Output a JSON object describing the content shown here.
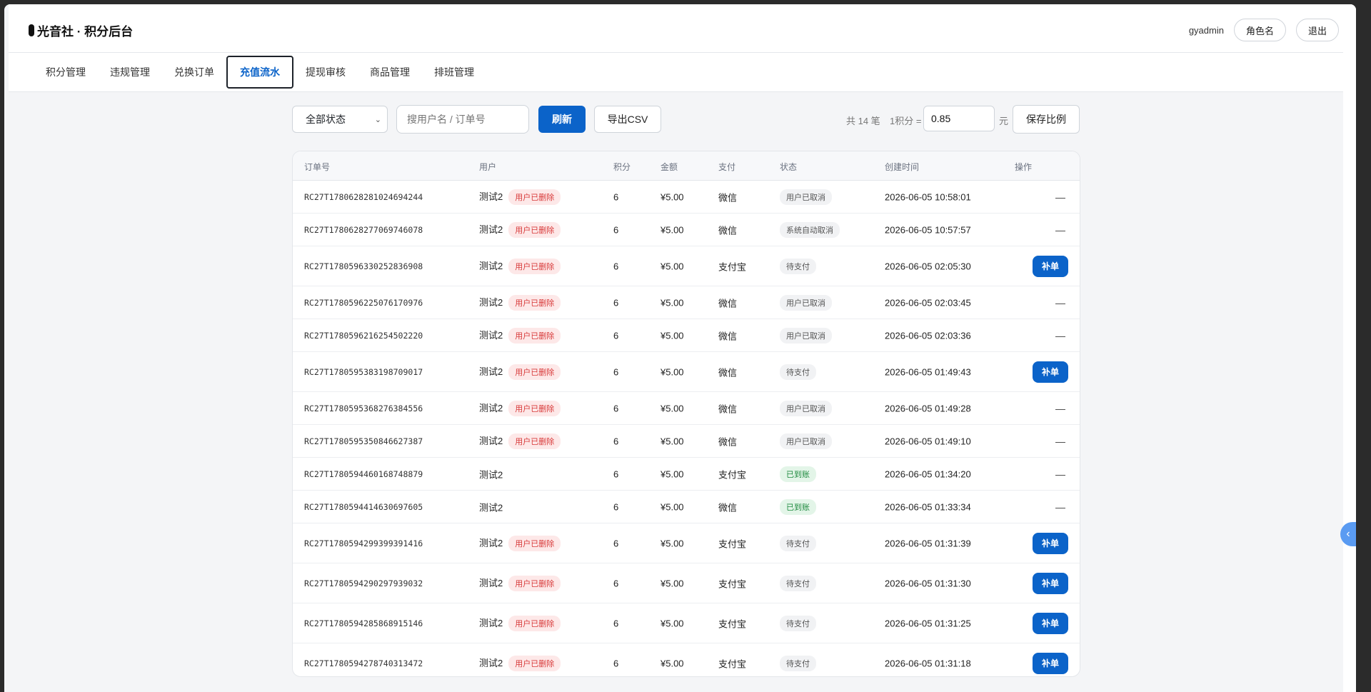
{
  "brand": {
    "title": "光音社 · 积分后台"
  },
  "header": {
    "username": "gyadmin",
    "role_label": "角色名",
    "logout_label": "退出"
  },
  "tabs": [
    {
      "label": "积分管理"
    },
    {
      "label": "违规管理"
    },
    {
      "label": "兑换订单"
    },
    {
      "label": "充值流水",
      "active": true
    },
    {
      "label": "提现审核"
    },
    {
      "label": "商品管理"
    },
    {
      "label": "排班管理"
    }
  ],
  "toolbar": {
    "status_select": "全部状态",
    "search_placeholder": "搜用户名 / 订单号",
    "refresh_label": "刷新",
    "export_label": "导出CSV",
    "total_text": "共 14 笔",
    "ratio_label": "1积分 =",
    "ratio_value": "0.85",
    "unit": "元",
    "save_label": "保存比例"
  },
  "table": {
    "headers": [
      "订单号",
      "用户",
      "积分",
      "金额",
      "支付",
      "状态",
      "创建时间",
      "操作"
    ],
    "deleted_badge": "用户已删除",
    "rows": [
      {
        "order": "RC27T1780628281024694244",
        "user": "测试2",
        "deleted": true,
        "points": "6",
        "amount": "¥5.00",
        "pay": "微信",
        "status": "用户已取消",
        "status_type": "cancel",
        "time": "2026-06-05 10:58:01",
        "action": "—"
      },
      {
        "order": "RC27T1780628277069746078",
        "user": "测试2",
        "deleted": true,
        "points": "6",
        "amount": "¥5.00",
        "pay": "微信",
        "status": "系统自动取消",
        "status_type": "cancel",
        "time": "2026-06-05 10:57:57",
        "action": "—"
      },
      {
        "order": "RC27T1780596330252836908",
        "user": "测试2",
        "deleted": true,
        "points": "6",
        "amount": "¥5.00",
        "pay": "支付宝",
        "status": "待支付",
        "status_type": "pending",
        "time": "2026-06-05 02:05:30",
        "action": "补单"
      },
      {
        "order": "RC27T1780596225076170976",
        "user": "测试2",
        "deleted": true,
        "points": "6",
        "amount": "¥5.00",
        "pay": "微信",
        "status": "用户已取消",
        "status_type": "cancel",
        "time": "2026-06-05 02:03:45",
        "action": "—"
      },
      {
        "order": "RC27T1780596216254502220",
        "user": "测试2",
        "deleted": true,
        "points": "6",
        "amount": "¥5.00",
        "pay": "微信",
        "status": "用户已取消",
        "status_type": "cancel",
        "time": "2026-06-05 02:03:36",
        "action": "—"
      },
      {
        "order": "RC27T1780595383198709017",
        "user": "测试2",
        "deleted": true,
        "points": "6",
        "amount": "¥5.00",
        "pay": "微信",
        "status": "待支付",
        "status_type": "pending",
        "time": "2026-06-05 01:49:43",
        "action": "补单"
      },
      {
        "order": "RC27T1780595368276384556",
        "user": "测试2",
        "deleted": true,
        "points": "6",
        "amount": "¥5.00",
        "pay": "微信",
        "status": "用户已取消",
        "status_type": "cancel",
        "time": "2026-06-05 01:49:28",
        "action": "—"
      },
      {
        "order": "RC27T1780595350846627387",
        "user": "测试2",
        "deleted": true,
        "points": "6",
        "amount": "¥5.00",
        "pay": "微信",
        "status": "用户已取消",
        "status_type": "cancel",
        "time": "2026-06-05 01:49:10",
        "action": "—"
      },
      {
        "order": "RC27T1780594460168748879",
        "user": "测试2",
        "deleted": false,
        "points": "6",
        "amount": "¥5.00",
        "pay": "支付宝",
        "status": "已到账",
        "status_type": "ok",
        "time": "2026-06-05 01:34:20",
        "action": "—"
      },
      {
        "order": "RC27T1780594414630697605",
        "user": "测试2",
        "deleted": false,
        "points": "6",
        "amount": "¥5.00",
        "pay": "微信",
        "status": "已到账",
        "status_type": "ok",
        "time": "2026-06-05 01:33:34",
        "action": "—"
      },
      {
        "order": "RC27T1780594299399391416",
        "user": "测试2",
        "deleted": true,
        "points": "6",
        "amount": "¥5.00",
        "pay": "支付宝",
        "status": "待支付",
        "status_type": "pending",
        "time": "2026-06-05 01:31:39",
        "action": "补单"
      },
      {
        "order": "RC27T1780594290297939032",
        "user": "测试2",
        "deleted": true,
        "points": "6",
        "amount": "¥5.00",
        "pay": "支付宝",
        "status": "待支付",
        "status_type": "pending",
        "time": "2026-06-05 01:31:30",
        "action": "补单"
      },
      {
        "order": "RC27T1780594285868915146",
        "user": "测试2",
        "deleted": true,
        "points": "6",
        "amount": "¥5.00",
        "pay": "支付宝",
        "status": "待支付",
        "status_type": "pending",
        "time": "2026-06-05 01:31:25",
        "action": "补单"
      },
      {
        "order": "RC27T1780594278740313472",
        "user": "测试2",
        "deleted": true,
        "points": "6",
        "amount": "¥5.00",
        "pay": "支付宝",
        "status": "待支付",
        "status_type": "pending",
        "time": "2026-06-05 01:31:18",
        "action": "补单"
      }
    ]
  },
  "colors": {
    "accent": "#0b63c9",
    "deleted_bg": "#fde8e8",
    "deleted_fg": "#d83a3a",
    "ok_bg": "#e3f5e8",
    "ok_fg": "#1f8a3f"
  },
  "icons": {
    "side_handle": "chevron-left-icon"
  }
}
